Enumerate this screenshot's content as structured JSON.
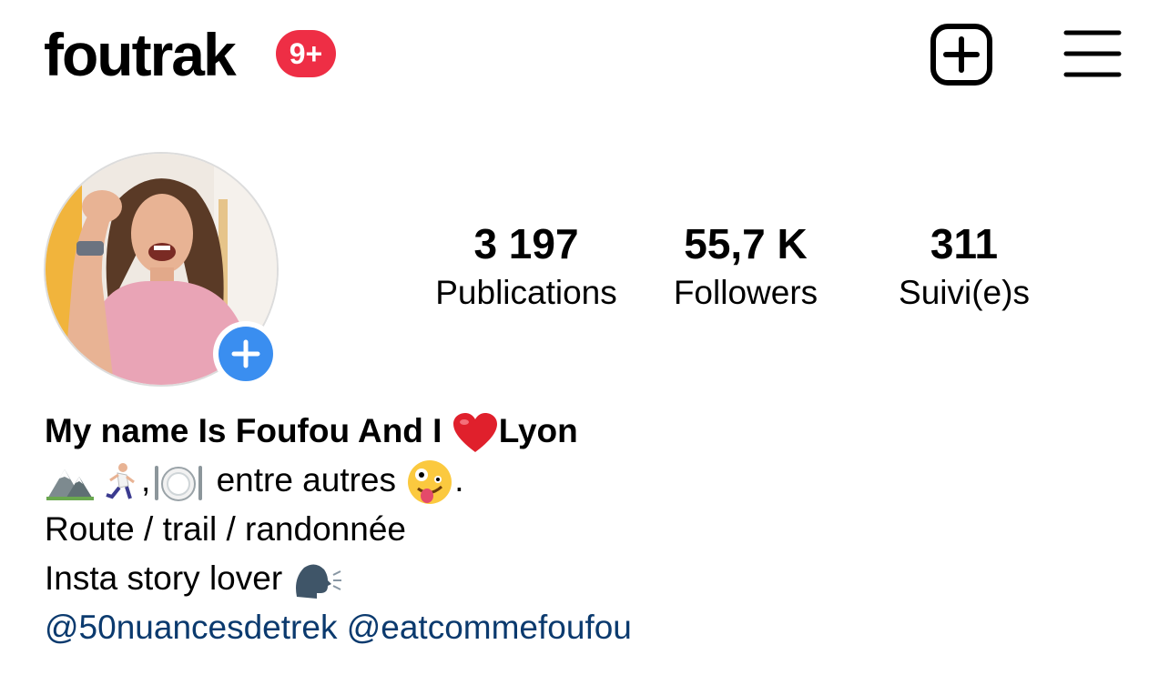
{
  "header": {
    "username": "foutrak",
    "notification_badge": "9+",
    "badge_color": "#ee2e45",
    "new_post_icon": "plus-square-icon",
    "menu_icon": "hamburger-menu-icon"
  },
  "profile": {
    "avatar_icon": "profile-photo",
    "add_story_icon": "plus-icon",
    "add_story_color": "#3a8ef0",
    "stats": [
      {
        "value": "3 197",
        "label": "Publications"
      },
      {
        "value": "55,7 K",
        "label": "Followers"
      },
      {
        "value": "311",
        "label": "Suivi(e)s"
      }
    ]
  },
  "bio": {
    "name_before": "My name Is Foufou And I",
    "name_after": "Lyon",
    "heart_icon": "red-heart-emoji",
    "line2_text": "entre autres",
    "line2_end": ".",
    "line2_icons": [
      "mountain-emoji",
      "woman-running-emoji",
      "fork-knife-plate-emoji",
      "zany-face-emoji"
    ],
    "line3": "Route / trail / randonnée",
    "line4_text": "Insta story lover",
    "line4_icon": "speaking-head-emoji",
    "mentions": [
      "@50nuancesdetrek",
      "@eatcommefoufou"
    ],
    "mention_color": "#0b3a6e"
  }
}
